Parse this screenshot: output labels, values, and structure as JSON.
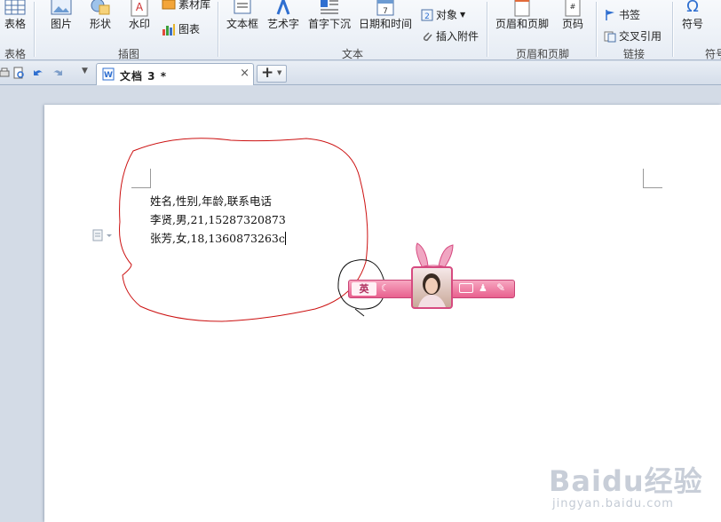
{
  "ribbon": {
    "table_group": {
      "button": "表格",
      "group_label": "表格"
    },
    "illustration_group": {
      "picture": "图片",
      "shape": "形状",
      "watermark": "水印",
      "material_lib": "素材库",
      "chart": "图表",
      "group_label": "插图"
    },
    "text_group": {
      "textbox": "文本框",
      "wordart": "艺术字",
      "dropcap": "首字下沉",
      "datetime": "日期和时间",
      "object": "对象",
      "attachment": "插入附件",
      "group_label": "文本"
    },
    "header_footer_group": {
      "header_footer": "页眉和页脚",
      "page_number": "页码",
      "group_label": "页眉和页脚"
    },
    "link_group": {
      "bookmark": "书签",
      "crossref": "交叉引用",
      "group_label": "链接"
    },
    "symbol_group": {
      "symbol": "符号",
      "symbol2": "符号"
    }
  },
  "tabs": {
    "doc_title": "文档 3 *",
    "close_glyph": "×",
    "new_glyph": "+"
  },
  "document": {
    "lines": [
      "姓名,性别,年龄,联系电话",
      "李贤,男,21,15287320873",
      "张芳,女,18,1360873263c"
    ]
  },
  "ime": {
    "mode": "英"
  },
  "watermark": {
    "main": "Baidu经验",
    "sub": "jingyan.baidu.com"
  },
  "colors": {
    "annotation_red": "#cc1111",
    "ime_pink": "#e8608e"
  }
}
